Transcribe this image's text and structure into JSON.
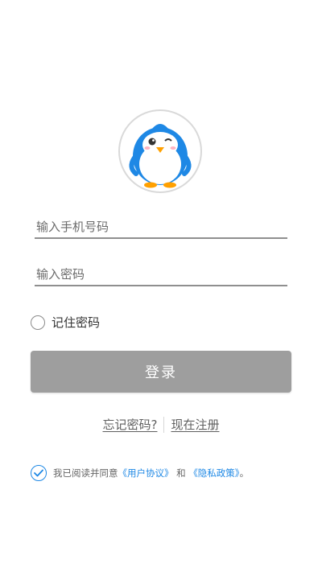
{
  "avatar": {
    "icon": "penguin-logo"
  },
  "login_form": {
    "phone_placeholder": "输入手机号码",
    "password_placeholder": "输入密码",
    "remember_label": "记住密码",
    "login_button": "登录"
  },
  "links": {
    "forgot_password": "忘记密码?",
    "register": "现在注册"
  },
  "agreement": {
    "prefix": "我已阅读并同意",
    "user_agreement": "《用户协议》",
    "and": "和",
    "privacy_policy": "《隐私政策》",
    "suffix": "。"
  },
  "colors": {
    "accent_blue": "#1e88e5",
    "button_gray": "#9e9e9e",
    "underline_gray": "#8f8f8f"
  }
}
